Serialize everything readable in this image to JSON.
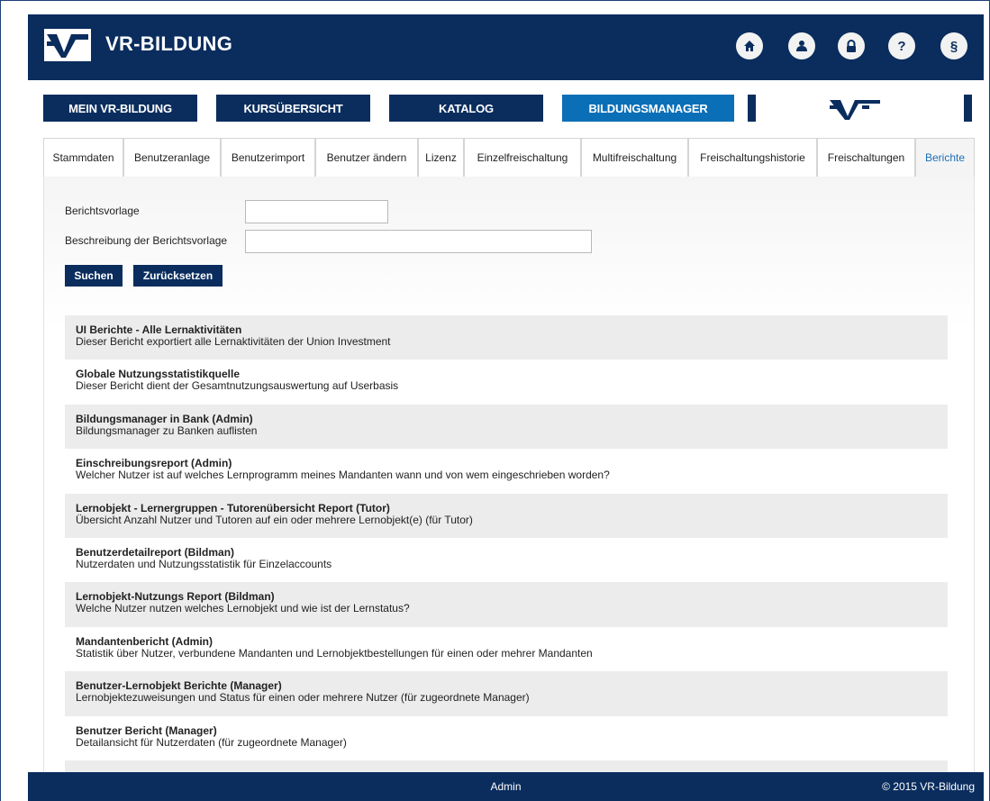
{
  "header": {
    "brand": "VR-BILDUNG",
    "icons": [
      "home-icon",
      "user-icon",
      "lock-icon",
      "help-icon",
      "paragraph-icon"
    ],
    "paragraph_glyph": "§",
    "help_glyph": "?"
  },
  "mainnav": {
    "items": [
      "MEIN VR-BILDUNG",
      "KURSÜBERSICHT",
      "KATALOG",
      "BILDUNGSMANAGER"
    ],
    "active": "BILDUNGSMANAGER"
  },
  "tabs": {
    "items": [
      "Stammdaten",
      "Benutzeranlage",
      "Benutzerimport",
      "Benutzer ändern",
      "Lizenz",
      "Einzelfreischaltung",
      "Multifreischaltung",
      "Freischaltungshistorie",
      "Freischaltungen",
      "Berichte"
    ],
    "active": "Berichte"
  },
  "form": {
    "template_label": "Berichtsvorlage",
    "template_value": "",
    "description_label": "Beschreibung der Berichtsvorlage",
    "description_value": "",
    "search_button": "Suchen",
    "reset_button": "Zurücksetzen"
  },
  "reports": [
    {
      "title": "UI Berichte - Alle Lernaktivitäten",
      "desc": "Dieser Bericht exportiert alle Lernaktivitäten der Union Investment"
    },
    {
      "title": "Globale Nutzungsstatistikquelle",
      "desc": "Dieser Bericht dient der Gesamtnutzungsauswertung auf Userbasis"
    },
    {
      "title": "Bildungsmanager in Bank (Admin)",
      "desc": "Bildungsmanager zu Banken auflisten"
    },
    {
      "title": "Einschreibungsreport (Admin)",
      "desc": "Welcher Nutzer ist auf welches Lernprogramm meines Mandanten wann und von wem eingeschrieben worden?"
    },
    {
      "title": "Lernobjekt - Lernergruppen - Tutorenübersicht Report (Tutor)",
      "desc": "Übersicht Anzahl Nutzer und Tutoren auf ein oder mehrere Lernobjekt(e) (für Tutor)"
    },
    {
      "title": "Benutzerdetailreport (Bildman)",
      "desc": "Nutzerdaten und Nutzungsstatistik für Einzelaccounts"
    },
    {
      "title": "Lernobjekt-Nutzungs Report (Bildman)",
      "desc": "Welche Nutzer nutzen welches Lernobjekt und wie ist der Lernstatus?"
    },
    {
      "title": "Mandantenbericht (Admin)",
      "desc": "Statistik über Nutzer, verbundene Mandanten und Lernobjektbestellungen für einen oder mehrer Mandanten"
    },
    {
      "title": "Benutzer-Lernobjekt Berichte (Manager)",
      "desc": "Lernobjektezuweisungen und Status für einen oder mehrere Nutzer (für zugeordnete Manager)"
    },
    {
      "title": "Benutzer Bericht (Manager)",
      "desc": "Detailansicht für Nutzerdaten (für zugeordnete Manager)"
    }
  ],
  "footer": {
    "center": "Admin",
    "right": "© 2015 VR-Bildung"
  },
  "colors": {
    "brand_dark": "#0a2d5e",
    "brand_active": "#0a6fb7",
    "active_tab_text": "#1b6fb8"
  }
}
